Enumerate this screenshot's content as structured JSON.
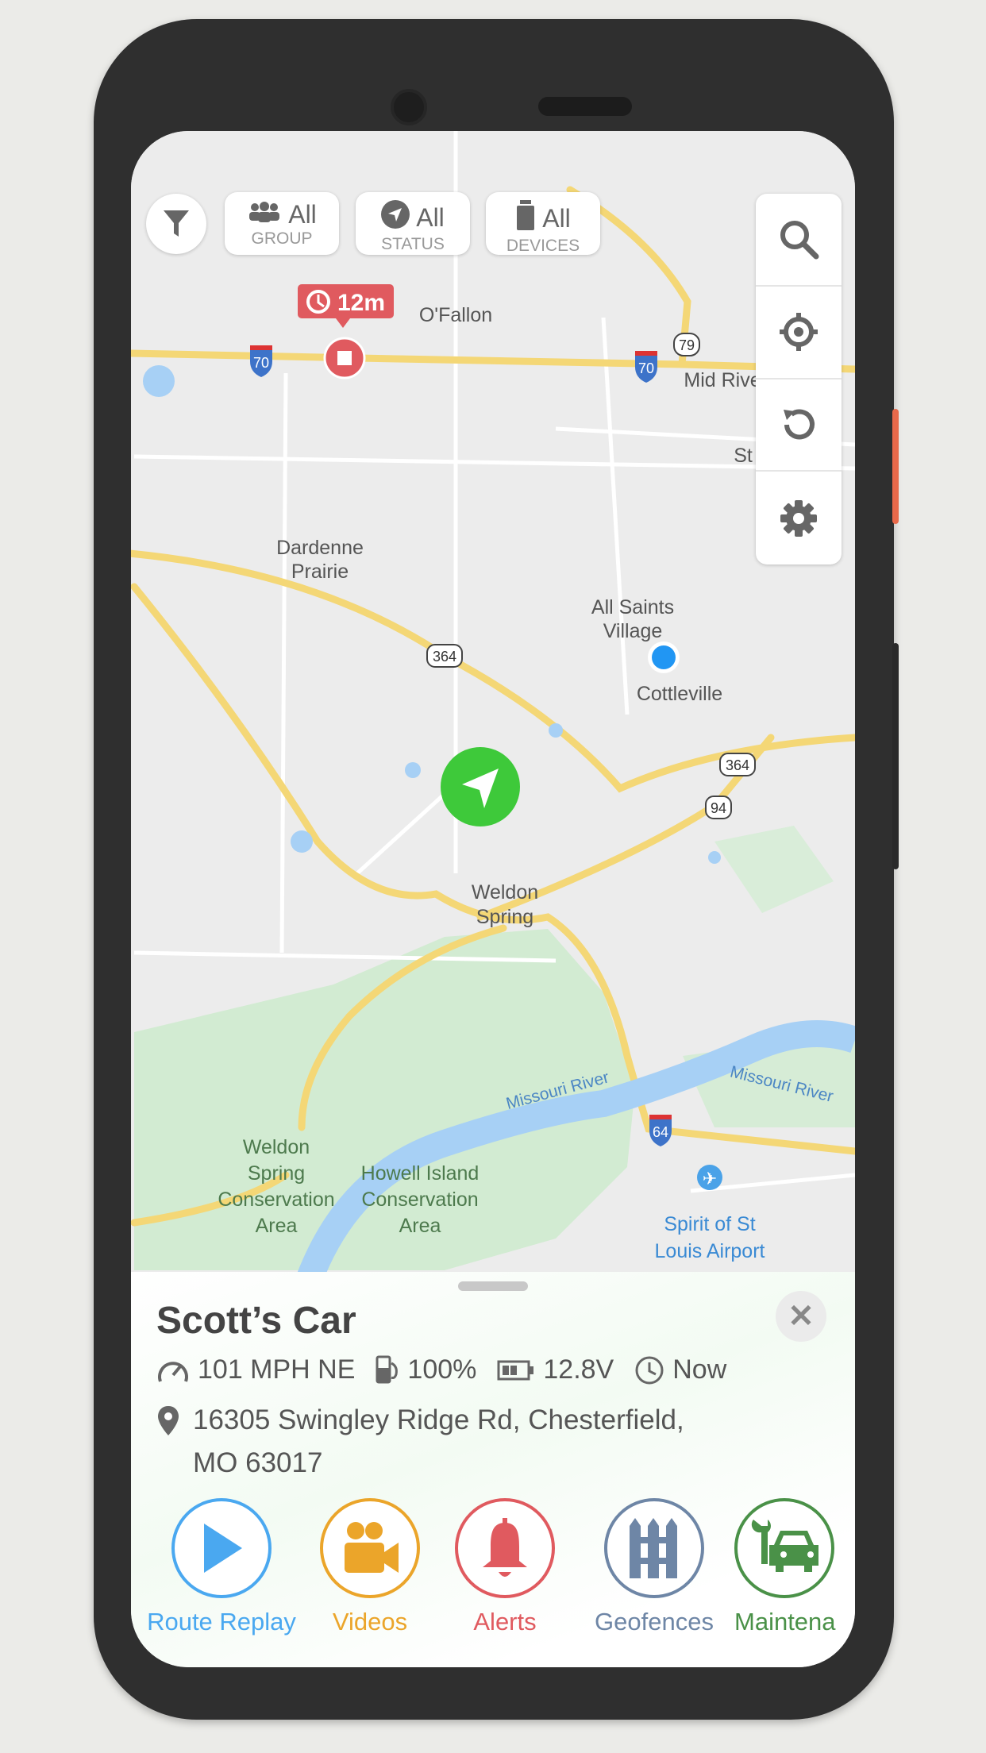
{
  "filters": {
    "group": {
      "value": "All",
      "label": "GROUP"
    },
    "status": {
      "value": "All",
      "label": "STATUS"
    },
    "devices": {
      "value": "All",
      "label": "DEVICES"
    }
  },
  "map": {
    "labels": {
      "ofallon": "O'Fallon",
      "mid_rivers": "Mid Rive",
      "st": "St",
      "dardenne_1": "Dardenne",
      "dardenne_2": "Prairie",
      "all_saints_1": "All Saints",
      "all_saints_2": "Village",
      "cottleville": "Cottleville",
      "weldon_1": "Weldon",
      "weldon_2": "Spring",
      "river_1": "Missouri River",
      "river_2": "Missouri River",
      "wsca_1": "Weldon",
      "wsca_2": "Spring",
      "wsca_3": "Conservation",
      "wsca_4": "Area",
      "hica_1": "Howell Island",
      "hica_2": "Conservation",
      "hica_3": "Area",
      "airport_1": "Spirit of St",
      "airport_2": "Louis Airport"
    },
    "shields": {
      "i70_a": "70",
      "i70_b": "70",
      "r79": "79",
      "r364_a": "364",
      "r364_b": "364",
      "r94": "94",
      "i64": "64"
    },
    "stop_marker": {
      "duration": "12m",
      "color": "#e05a5f"
    },
    "vehicle_marker_color": "#3ec93a",
    "user_location_color": "#2196f3"
  },
  "toolbar": {
    "icons": [
      "search-icon",
      "locate-icon",
      "refresh-icon",
      "settings-icon"
    ]
  },
  "vehicle": {
    "name": "Scott’s Car",
    "speed": "101 MPH NE",
    "fuel": "100%",
    "battery": "12.8V",
    "last_update": "Now",
    "address_line1": "16305 Swingley Ridge Rd, Chesterfield,",
    "address_line2": "MO 63017"
  },
  "actions": [
    {
      "label": "Route Replay",
      "color": "#4aa8f0"
    },
    {
      "label": "Videos",
      "color": "#eba52a"
    },
    {
      "label": "Alerts",
      "color": "#e05a5f"
    },
    {
      "label": "Geofences",
      "color": "#6e86a6"
    },
    {
      "label": "Maintena",
      "color": "#4a9148"
    }
  ]
}
